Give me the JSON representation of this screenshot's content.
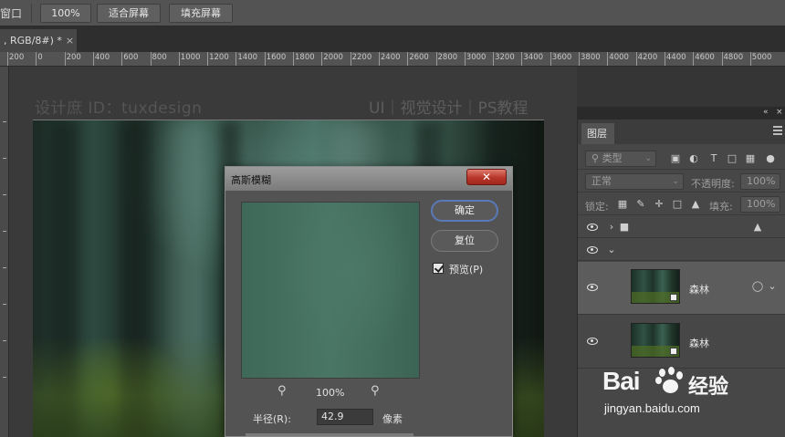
{
  "options_bar": {
    "window_label": "窗口",
    "zoom_btn": "100%",
    "fit_screen_btn": "适合屏幕",
    "fill_screen_btn": "填充屏幕"
  },
  "doc_tab": {
    "title": ", RGB/8#) *",
    "close": "×"
  },
  "ruler": {
    "labels": [
      "200",
      "0",
      "200",
      "400",
      "600",
      "800",
      "1000",
      "1200",
      "1400",
      "1600",
      "1800",
      "2000",
      "2200",
      "2400",
      "2600",
      "2800",
      "3000",
      "3200",
      "3400",
      "3600",
      "3800",
      "4000",
      "4200",
      "4400",
      "4600",
      "4800",
      "5000"
    ]
  },
  "canvas": {
    "watermark_left": "设计庶 ID：tuxdesign",
    "watermark_right": "UI｜视觉设计｜PS教程"
  },
  "dialog": {
    "title": "高斯模糊",
    "close": "✕",
    "ok_label": "确定",
    "reset_label": "复位",
    "preview_label": "预览(P)",
    "preview_checked": true,
    "zoom_out_icon": "zoom-out-icon",
    "zoom_in_icon": "zoom-in-icon",
    "zoom_percent": "100%",
    "radius_label": "半径(R):",
    "radius_value": "42.9",
    "radius_unit": "像素"
  },
  "layers_panel": {
    "top_controls": "«",
    "top_close": "×",
    "tab_label": "图层",
    "filter_kind": "类型",
    "blend_mode": "正常",
    "opacity_label": "不透明度:",
    "opacity_value": "100%",
    "lock_label": "锁定:",
    "fill_label": "填充:",
    "fill_value": "100%",
    "layers": [
      {
        "name": "森林",
        "selected": true
      },
      {
        "name": "森林",
        "selected": false
      }
    ]
  },
  "baidu_watermark": {
    "brand": "Bai",
    "brand_cn": "经验",
    "url": "jingyan.baidu.com"
  }
}
